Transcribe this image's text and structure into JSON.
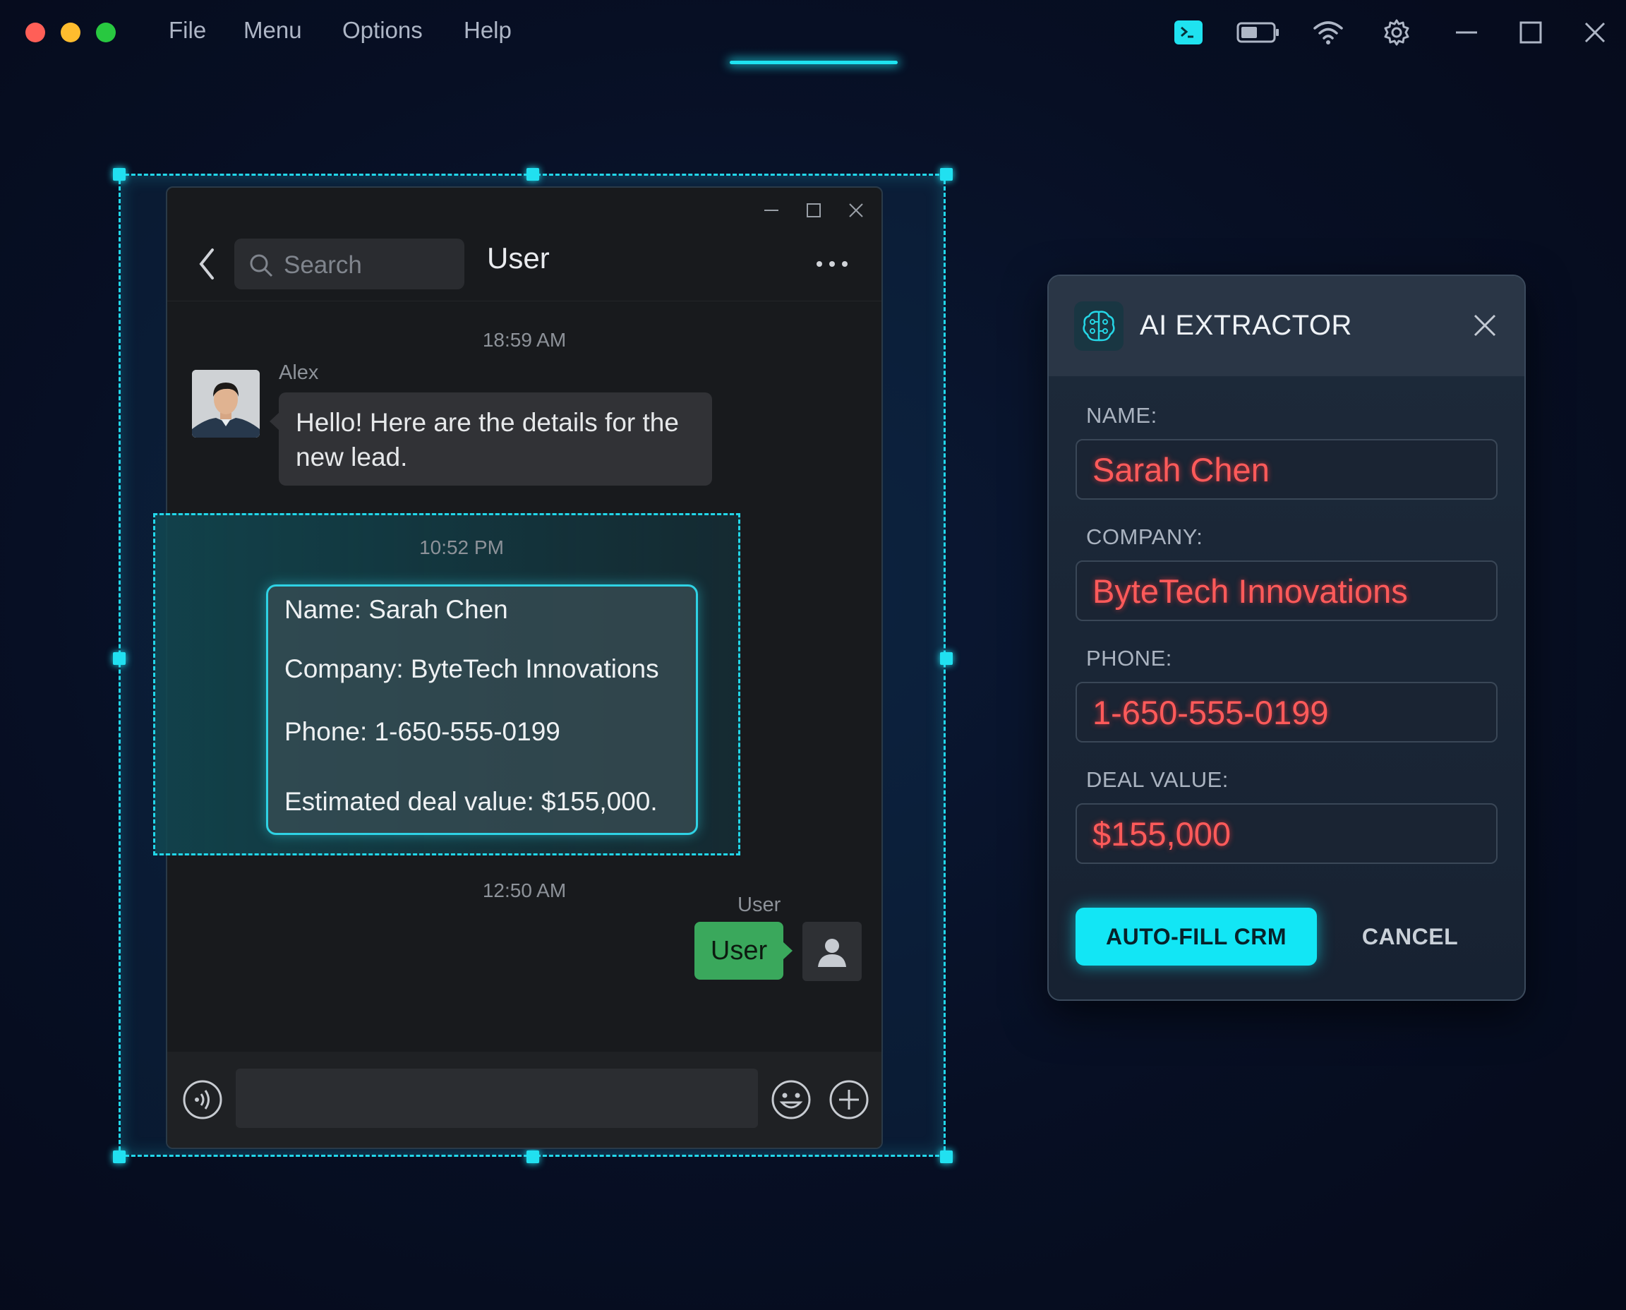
{
  "menubar": {
    "items": [
      "File",
      "Menu",
      "Options",
      "Help"
    ],
    "status_icons": [
      "terminal-icon",
      "battery-icon",
      "wifi-icon",
      "gear-icon",
      "minimize-icon",
      "maximize-icon",
      "close-icon"
    ]
  },
  "chat": {
    "search_placeholder": "Search",
    "title": "User",
    "messages": [
      {
        "timestamp": "18:59 AM",
        "sender": "Alex",
        "text": "Hello! Here are the details for the new lead."
      },
      {
        "timestamp": "10:52 PM",
        "lines": [
          "Name: Sarah Chen",
          "Company: ByteTech Innovations",
          "Phone: 1-650-555-0199",
          "Estimated deal value: $155,000."
        ]
      },
      {
        "timestamp": "12:50 AM",
        "sender": "User",
        "text": "User"
      }
    ]
  },
  "extractor": {
    "title": "AI EXTRACTOR",
    "fields": [
      {
        "label": "NAME:",
        "value": "Sarah Chen"
      },
      {
        "label": "COMPANY:",
        "value": "ByteTech Innovations"
      },
      {
        "label": "PHONE:",
        "value": "1-650-555-0199"
      },
      {
        "label": "DEAL VALUE:",
        "value": "$155,000"
      }
    ],
    "primary_button": "AUTO-FILL CRM",
    "secondary_button": "CANCEL"
  },
  "colors": {
    "accent": "#22d7ea",
    "extracted_text": "#ff5a5a",
    "outgoing_bubble": "#3aa85c"
  }
}
